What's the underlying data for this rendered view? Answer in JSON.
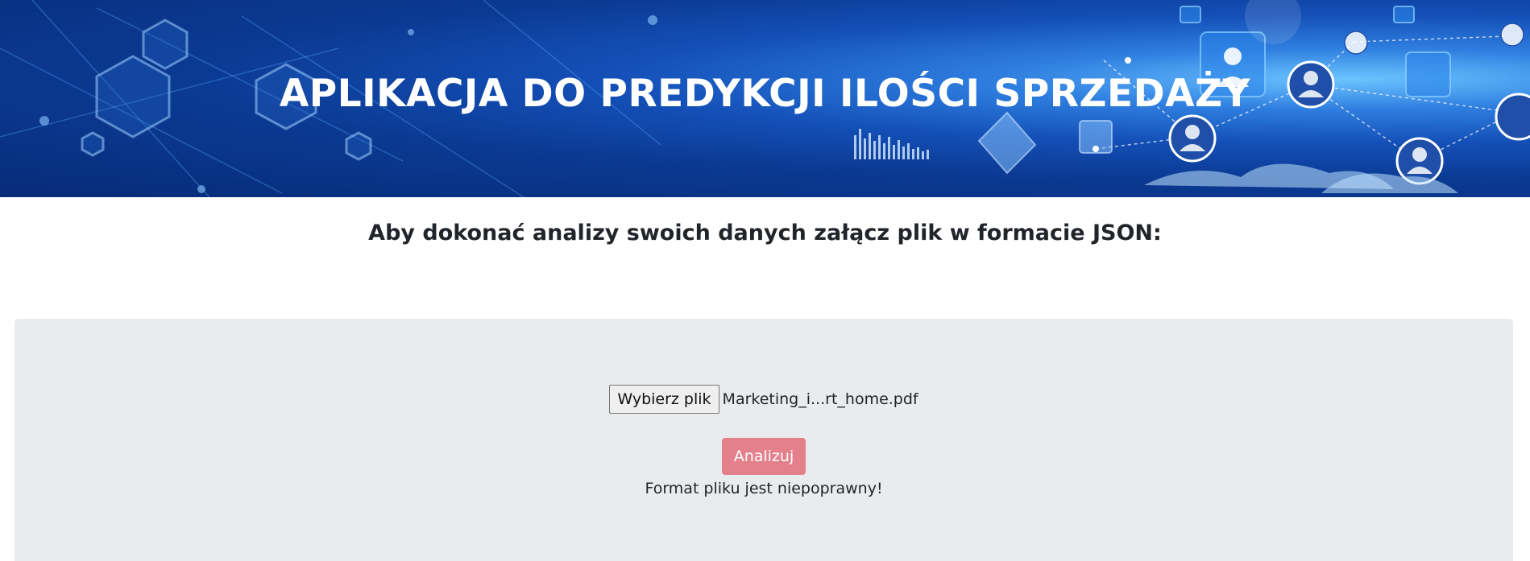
{
  "header": {
    "title": "APLIKACJA DO PREDYKCJI ILOŚCI SPRZEDAŻY"
  },
  "instructions": {
    "text": "Aby dokonać analizy swoich danych załącz plik w formacie JSON:"
  },
  "upload": {
    "choose_file_label": "Wybierz plik",
    "selected_file": "Marketing_i...rt_home.pdf",
    "analyze_label": "Analizuj",
    "error_message": "Format pliku jest niepoprawny!"
  },
  "colors": {
    "banner_primary": "#0b3a93",
    "panel_background": "#e9ecef",
    "analyze_button": "#e4808c"
  }
}
